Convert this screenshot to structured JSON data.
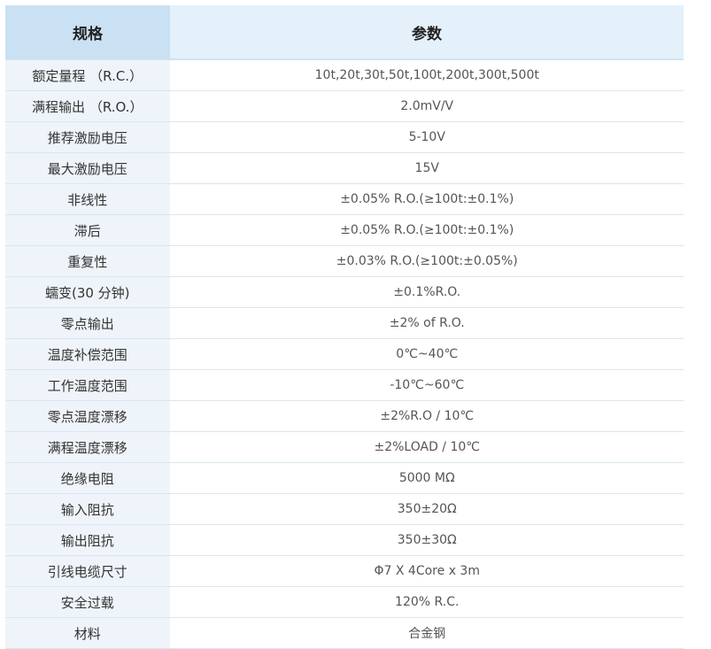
{
  "header": {
    "col1": "规格",
    "col2": "参数"
  },
  "rows": [
    {
      "name": "额定量程  （R.C.）",
      "value": "10t,20t,30t,50t,100t,200t,300t,500t"
    },
    {
      "name": "满程输出  （R.O.）",
      "value": "2.0mV/V"
    },
    {
      "name": "推荐激励电压",
      "value": "5-10V"
    },
    {
      "name": "最大激励电压",
      "value": "15V"
    },
    {
      "name": "非线性",
      "value": "±0.05% R.O.(≥100t:±0.1%)"
    },
    {
      "name": "滞后",
      "value": "±0.05% R.O.(≥100t:±0.1%)"
    },
    {
      "name": "重复性",
      "value": "±0.03% R.O.(≥100t:±0.05%)"
    },
    {
      "name": "蠕变(30 分钟)",
      "value": "±0.1%R.O."
    },
    {
      "name": "零点输出",
      "value": "±2% of R.O."
    },
    {
      "name": "温度补偿范围",
      "value": "0℃~40℃"
    },
    {
      "name": "工作温度范围",
      "value": "-10℃~60℃"
    },
    {
      "name": "零点温度漂移",
      "value": "±2%R.O / 10℃"
    },
    {
      "name": "满程温度漂移",
      "value": "±2%LOAD / 10℃"
    },
    {
      "name": "绝缘电阻",
      "value": "5000 MΩ"
    },
    {
      "name": "输入阻抗",
      "value": "350±20Ω"
    },
    {
      "name": "输出阻抗",
      "value": "350±30Ω"
    },
    {
      "name": "引线电缆尺寸",
      "value": "Φ7 X 4Core x 3m"
    },
    {
      "name": "安全过载",
      "value": "120% R.C."
    },
    {
      "name": "材料",
      "value": "合金钢"
    }
  ]
}
